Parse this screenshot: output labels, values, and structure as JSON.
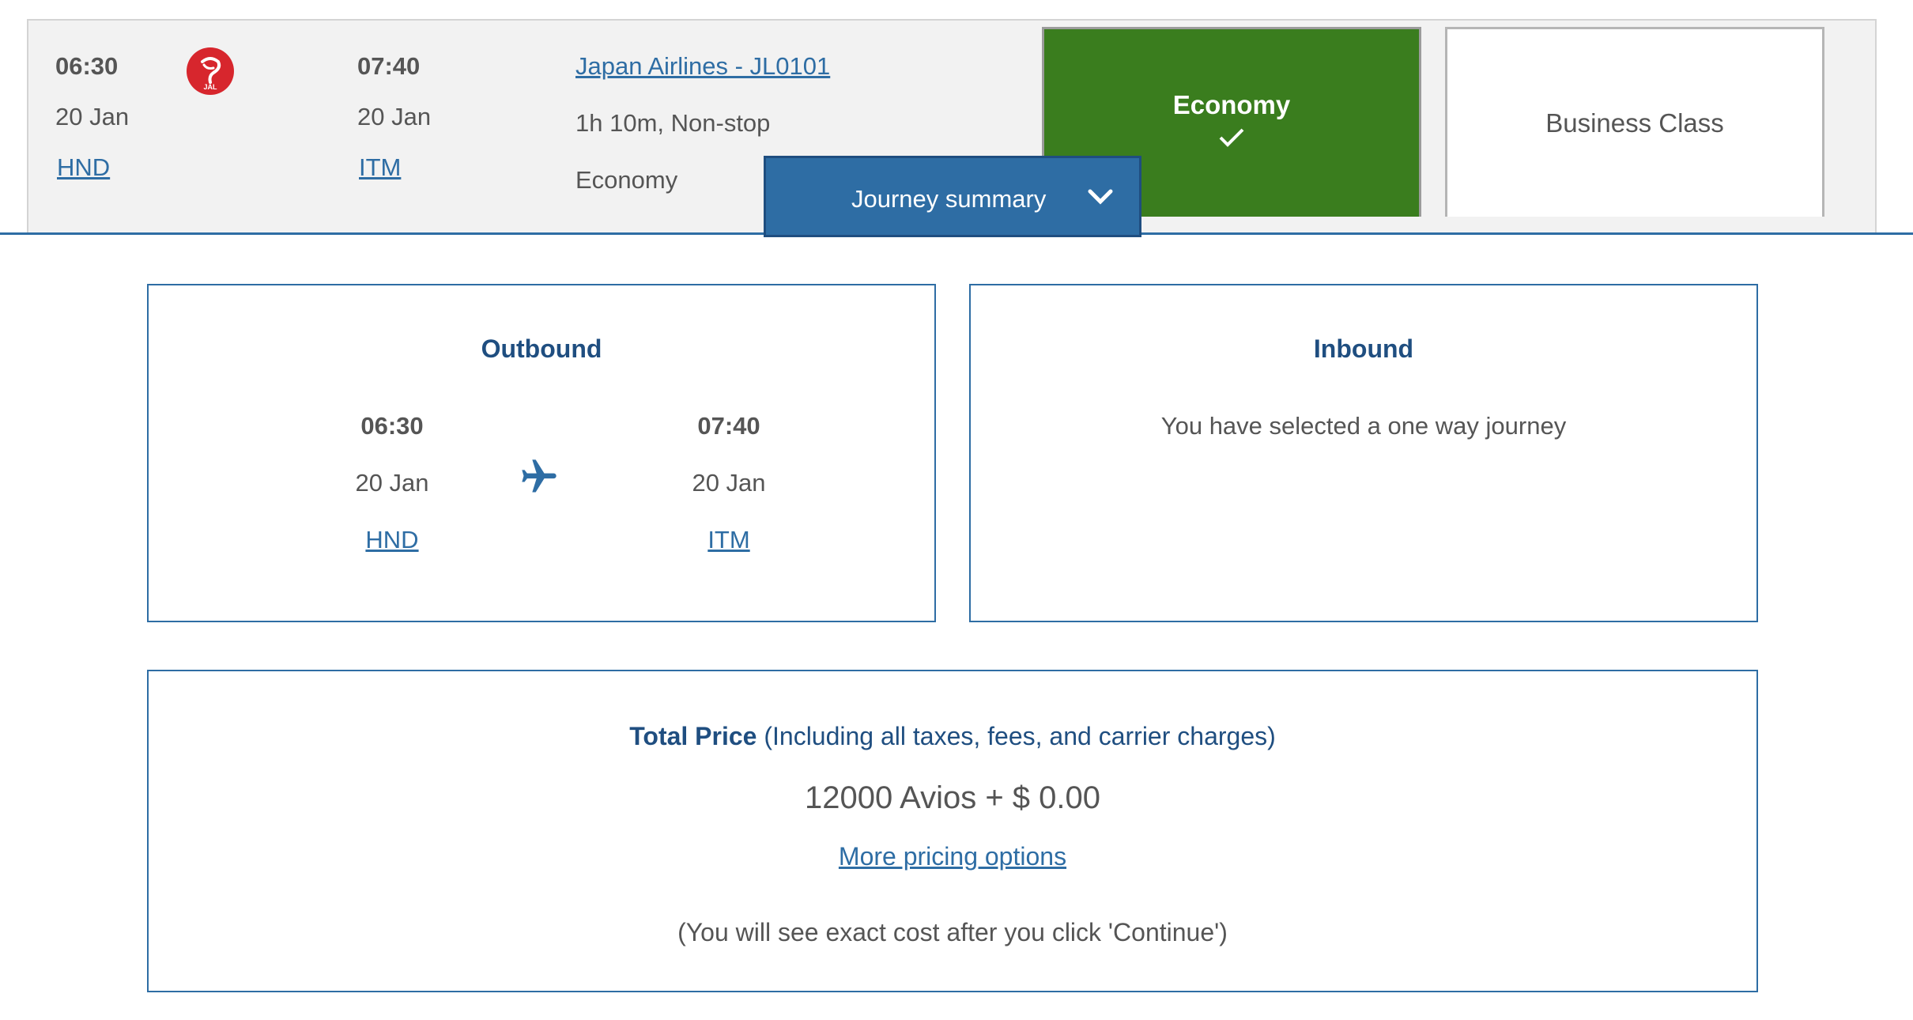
{
  "flight": {
    "departure": {
      "time": "06:30",
      "date": "20 Jan",
      "airport": "HND"
    },
    "arrival": {
      "time": "07:40",
      "date": "20 Jan",
      "airport": "ITM"
    },
    "airline_link": "Japan Airlines - JL0101",
    "duration": "1h 10m, Non-stop",
    "cabin": "Economy",
    "logo_text": "JAL"
  },
  "cabins": {
    "economy_label": "Economy",
    "business_label": "Business Class"
  },
  "journey_summary": {
    "label": "Journey summary"
  },
  "outbound": {
    "title": "Outbound",
    "dep_time": "06:30",
    "dep_date": "20 Jan",
    "dep_airport": "HND",
    "arr_time": "07:40",
    "arr_date": "20 Jan",
    "arr_airport": "ITM"
  },
  "inbound": {
    "title": "Inbound",
    "message": "You have selected a one way journey"
  },
  "price": {
    "label": "Total Price",
    "note": " (Including all taxes, fees, and carrier charges)",
    "amount": "12000 Avios + $ 0.00",
    "more_options": "More pricing options",
    "footnote": "(You will see exact cost after you click 'Continue')"
  },
  "colors": {
    "brand_blue": "#2e6da4",
    "selected_green": "#3a7d1e",
    "jal_red": "#d7262d"
  }
}
